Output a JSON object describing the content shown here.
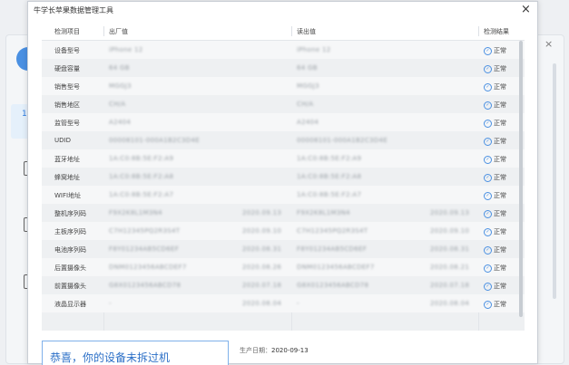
{
  "dialog": {
    "title": "牛学长苹果数据管理工具",
    "close_glyph": "×"
  },
  "table": {
    "headers": {
      "item": "检测项目",
      "factory": "出厂值",
      "read": "读出值",
      "result": "检测结果"
    },
    "rows": [
      {
        "name": "设备型号",
        "factory": "iPhone 12",
        "factory_date": "",
        "read": "iPhone 12",
        "read_date": "",
        "result": "正常"
      },
      {
        "name": "硬盘容量",
        "factory": "64 GB",
        "factory_date": "",
        "read": "64 GB",
        "read_date": "",
        "result": "正常"
      },
      {
        "name": "销售型号",
        "factory": "MGGJ3",
        "factory_date": "",
        "read": "MGGJ3",
        "read_date": "",
        "result": "正常"
      },
      {
        "name": "销售地区",
        "factory": "CH/A",
        "factory_date": "",
        "read": "CH/A",
        "read_date": "",
        "result": "正常"
      },
      {
        "name": "监管型号",
        "factory": "A2404",
        "factory_date": "",
        "read": "A2404",
        "read_date": "",
        "result": "正常"
      },
      {
        "name": "UDID",
        "factory": "00008101-000A1B2C3D4E",
        "factory_date": "",
        "read": "00008101-000A1B2C3D4E",
        "read_date": "",
        "result": "正常"
      },
      {
        "name": "蓝牙地址",
        "factory": "1A:C0:8B:5E:F2:A9",
        "factory_date": "",
        "read": "1A:C0:8B:5E:F2:A9",
        "read_date": "",
        "result": "正常"
      },
      {
        "name": "蜂窝地址",
        "factory": "1A:C0:8B:5E:F2:A8",
        "factory_date": "",
        "read": "1A:C0:8B:5E:F2:A8",
        "read_date": "",
        "result": "正常"
      },
      {
        "name": "WIFI地址",
        "factory": "1A:C0:8B:5E:F2:A7",
        "factory_date": "",
        "read": "1A:C0:8B:5E:F2:A7",
        "read_date": "",
        "result": "正常"
      },
      {
        "name": "整机序列码",
        "factory": "F9X2K8L1M3N4",
        "factory_date": "2020.09.13",
        "read": "F9X2K8L1M3N4",
        "read_date": "2020.09.13",
        "result": "正常"
      },
      {
        "name": "主板序列码",
        "factory": "C7H12345PQ2R3S4T",
        "factory_date": "2020.09.10",
        "read": "C7H12345PQ2R3S4T",
        "read_date": "2020.09.10",
        "result": "正常"
      },
      {
        "name": "电池序列码",
        "factory": "F8Y01234AB5CD6EF",
        "factory_date": "2020.08.31",
        "read": "F8Y01234AB5CD6EF",
        "read_date": "2020.08.31",
        "result": "正常"
      },
      {
        "name": "后置摄像头",
        "factory": "DNM0123456ABCDEF7",
        "factory_date": "2020.08.26",
        "read": "DNM0123456ABCDEF7",
        "read_date": "2020.08.21",
        "result": "正常"
      },
      {
        "name": "前置摄像头",
        "factory": "G8X0123456ABCD78",
        "factory_date": "2020.07.18",
        "read": "G8X0123456ABCD78",
        "read_date": "2020.07.18",
        "result": "正常"
      },
      {
        "name": "液晶显示器",
        "factory": "-",
        "factory_date": "2020.08.04",
        "read": "-",
        "read_date": "2020.08.04",
        "result": "正常"
      }
    ]
  },
  "banner": {
    "text": "恭喜，你的设备未拆过机"
  },
  "production": {
    "label": "生产日期：",
    "value": "2020-09-13"
  },
  "colors": {
    "accent": "#2b6fc7",
    "ok": "#4a90e2"
  },
  "icons": {
    "ok": "check-circle-icon",
    "close": "close-icon"
  }
}
